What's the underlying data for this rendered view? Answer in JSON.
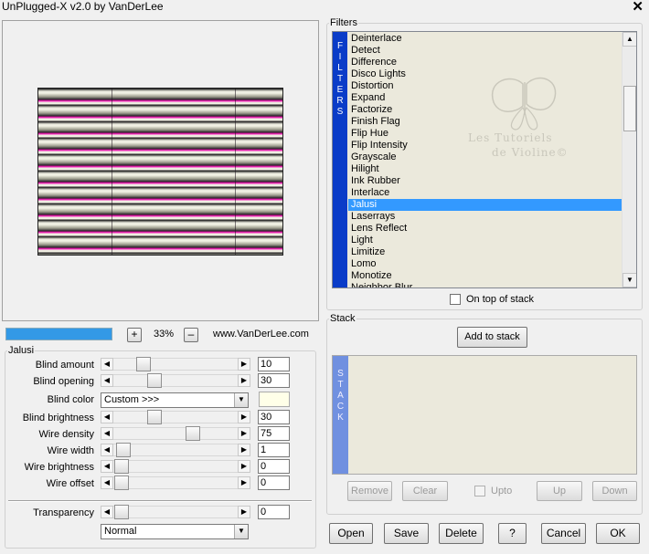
{
  "window": {
    "title": "UnPlugged-X v2.0 by VanDerLee"
  },
  "preview": {
    "zoom": "33%",
    "zoom_in": "+",
    "zoom_out": "–",
    "website": "www.VanDerLee.com"
  },
  "params": {
    "group_title": "Jalusi",
    "blind_amount": {
      "label": "Blind amount",
      "value": "10"
    },
    "blind_opening": {
      "label": "Blind opening",
      "value": "30"
    },
    "blind_color": {
      "label": "Blind color",
      "option": "Custom >>>",
      "swatch": "#ffffe8"
    },
    "blind_brightness": {
      "label": "Blind brightness",
      "value": "30"
    },
    "wire_density": {
      "label": "Wire density",
      "value": "75"
    },
    "wire_width": {
      "label": "Wire width",
      "value": "1"
    },
    "wire_brightness": {
      "label": "Wire brightness",
      "value": "0"
    },
    "wire_offset": {
      "label": "Wire offset",
      "value": "0"
    },
    "transparency": {
      "label": "Transparency",
      "value": "0"
    },
    "blend_mode": "Normal"
  },
  "filters": {
    "group_title": "Filters",
    "strip_label": [
      "F",
      "I",
      "L",
      "T",
      "E",
      "R",
      "S"
    ],
    "items": [
      "Deinterlace",
      "Detect",
      "Difference",
      "Disco Lights",
      "Distortion",
      "Expand",
      "Factorize",
      "Finish Flag",
      "Flip Hue",
      "Flip Intensity",
      "Grayscale",
      "Hilight",
      "Ink Rubber",
      "Interlace",
      "Jalusi",
      "Laserrays",
      "Lens Reflect",
      "Light",
      "Limitize",
      "Lomo",
      "Monotize",
      "Neighbor Blur"
    ],
    "selected": "Jalusi",
    "on_top_label": "On top of stack",
    "watermark_line1": "Les Tutoriels",
    "watermark_line2": "de Violine©"
  },
  "stack": {
    "group_title": "Stack",
    "add_label": "Add to stack",
    "strip_label": [
      "S",
      "T",
      "A",
      "C",
      "K"
    ],
    "remove_label": "Remove",
    "clear_label": "Clear",
    "upto_label": "Upto",
    "up_label": "Up",
    "down_label": "Down"
  },
  "footer": {
    "open_label": "Open",
    "save_label": "Save",
    "delete_label": "Delete",
    "help_label": "?",
    "cancel_label": "Cancel",
    "ok_label": "OK"
  },
  "colors": {
    "selection": "#3399ff",
    "filter_strip": "#0a3cc8",
    "stack_strip": "#7090e0",
    "progress": "#3399e6"
  },
  "slider_levels": {
    "blind_amount": 0.2,
    "blind_opening": 0.3,
    "blind_brightness": 0.3,
    "wire_density": 0.65,
    "wire_width": 0.02,
    "wire_brightness": 0.0,
    "wire_offset": 0.0,
    "transparency": 0.0
  },
  "list_scroll_fraction": 0.25
}
